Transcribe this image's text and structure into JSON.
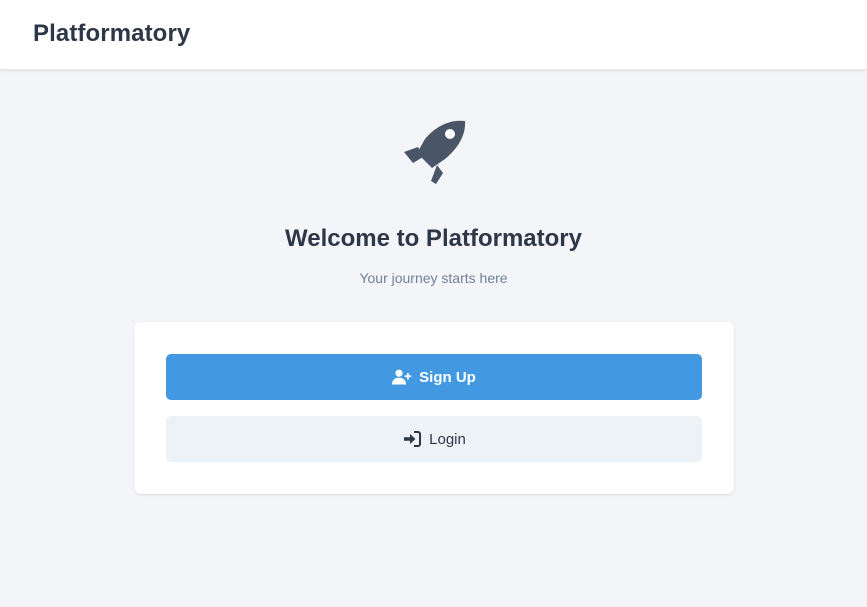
{
  "header": {
    "brand": "Platformatory"
  },
  "hero": {
    "icon": "rocket-icon",
    "title": "Welcome to Platformatory",
    "subtitle": "Your journey starts here"
  },
  "actions": {
    "signup": {
      "label": "Sign Up",
      "icon": "user-plus-icon"
    },
    "login": {
      "label": "Login",
      "icon": "sign-in-icon"
    }
  },
  "colors": {
    "primary": "#4299e1",
    "secondary": "#edf2f7",
    "text": "#2d3748",
    "muted": "#718096",
    "background": "#f4f5f8"
  }
}
